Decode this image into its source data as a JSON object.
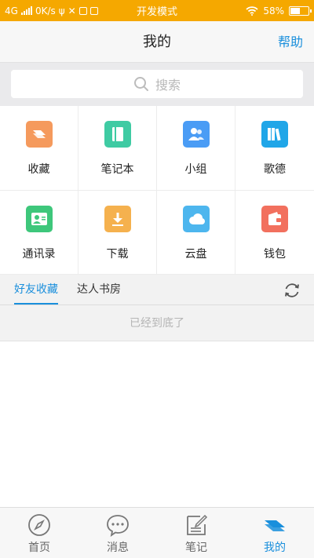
{
  "status_bar": {
    "network": "4G",
    "speed": "0K/s",
    "mode": "开发模式",
    "battery_text": "58%",
    "battery_level": 0.58
  },
  "nav": {
    "title": "我的",
    "help": "帮助"
  },
  "search": {
    "placeholder": "搜索"
  },
  "grid": [
    {
      "label": "收藏",
      "icon": "favorites-icon",
      "color": "#f59a5d"
    },
    {
      "label": "笔记本",
      "icon": "notebook-icon",
      "color": "#3fcba3"
    },
    {
      "label": "小组",
      "icon": "group-icon",
      "color": "#4a9cf5"
    },
    {
      "label": "歌德",
      "icon": "books-icon",
      "color": "#20a6e8"
    },
    {
      "label": "通讯录",
      "icon": "contacts-icon",
      "color": "#3ec77b"
    },
    {
      "label": "下载",
      "icon": "download-icon",
      "color": "#f5b14e"
    },
    {
      "label": "云盘",
      "icon": "cloud-icon",
      "color": "#4db6ee"
    },
    {
      "label": "钱包",
      "icon": "wallet-icon",
      "color": "#f2705e"
    }
  ],
  "tabs": {
    "friends": "好友收藏",
    "experts": "达人书房"
  },
  "end_text": "已经到底了",
  "tabbar": [
    {
      "label": "首页",
      "icon": "compass-icon"
    },
    {
      "label": "消息",
      "icon": "message-icon"
    },
    {
      "label": "笔记",
      "icon": "note-icon"
    },
    {
      "label": "我的",
      "icon": "profile-layers-icon",
      "active": true
    }
  ],
  "colors": {
    "accent": "#1a8fdc",
    "status_bar": "#f5a800"
  }
}
